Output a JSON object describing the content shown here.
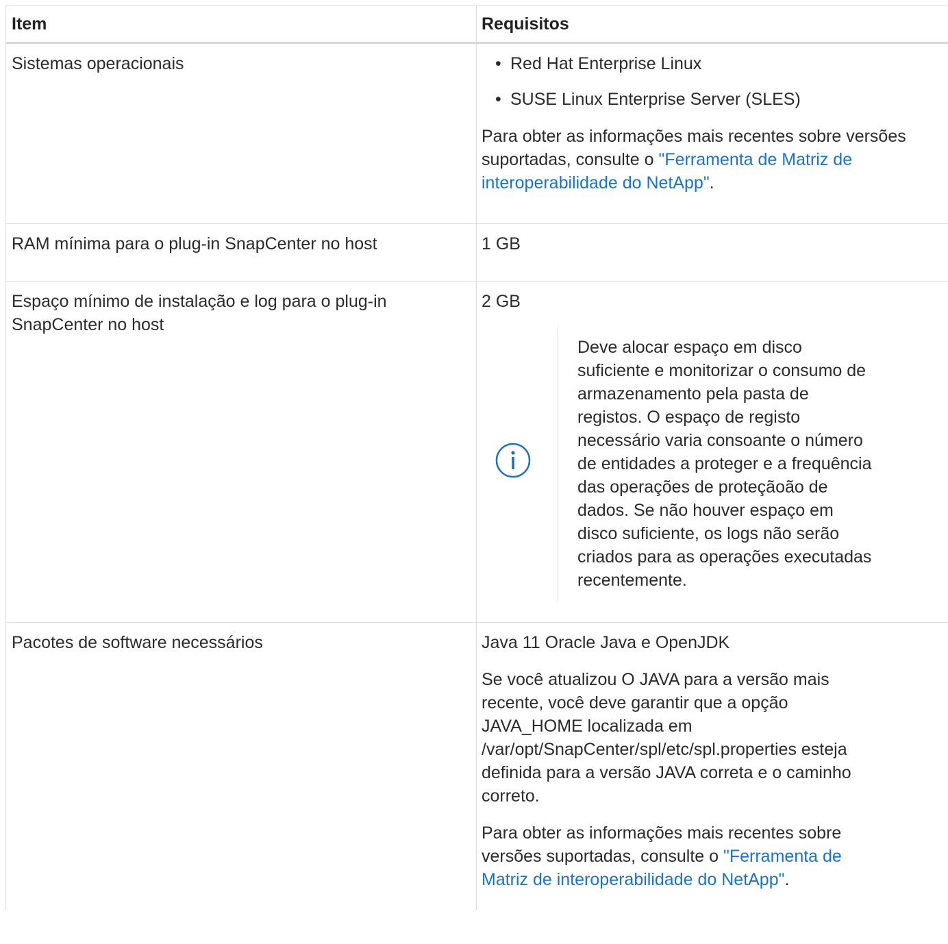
{
  "header": {
    "col_item": "Item",
    "col_requirements": "Requisitos"
  },
  "rows": [
    {
      "item": "Sistemas operacionais",
      "os_list": [
        "Red Hat Enterprise Linux",
        "SUSE Linux Enterprise Server (SLES)"
      ],
      "info_prefix": "Para obter as informações mais recentes sobre versões suportadas, consulte o ",
      "link_text": "\"Ferramenta de Matriz de interoperabilidade do NetApp\"",
      "info_suffix": "."
    },
    {
      "item": "RAM mínima para o plug-in SnapCenter no host",
      "value": "1 GB"
    },
    {
      "item_lines": [
        "Espaço mínimo de instalação e log para o plug-in",
        "SnapCenter no host"
      ],
      "value": "2 GB",
      "note_icon": "info-circle-icon",
      "note_lines": [
        "Deve alocar espaço em disco",
        "suficiente e monitorizar o consumo de",
        "armazenamento pela pasta de",
        "registos. O espaço de registo",
        "necessário varia consoante o número",
        "de entidades a proteger e a frequência",
        "das operações de proteçãoão de",
        "dados. Se não houver espaço em",
        "disco suficiente, os logs não serão",
        "criados para as operações executadas",
        "recentemente."
      ]
    },
    {
      "item": "Pacotes de software necessários",
      "value": "Java 11 Oracle Java e OpenJDK",
      "java_lines": [
        "Se você atualizou O JAVA para a versão mais",
        "recente, você deve garantir que a opção",
        "JAVA_HOME localizada em",
        "/var/opt/SnapCenter/spl/etc/spl.properties esteja",
        "definida para a versão JAVA correta e o caminho",
        "correto."
      ],
      "info_line1": "Para obter as informações mais recentes sobre",
      "info_line2_prefix": "versões suportadas, consulte o ",
      "link_line1": "\"Ferramenta de",
      "link_line2": "Matriz de interoperabilidade do NetApp\"",
      "info_suffix": "."
    }
  ],
  "colors": {
    "link": "#1a73c8",
    "icon": "#1f6fbf",
    "border": "#dcdcdc"
  }
}
